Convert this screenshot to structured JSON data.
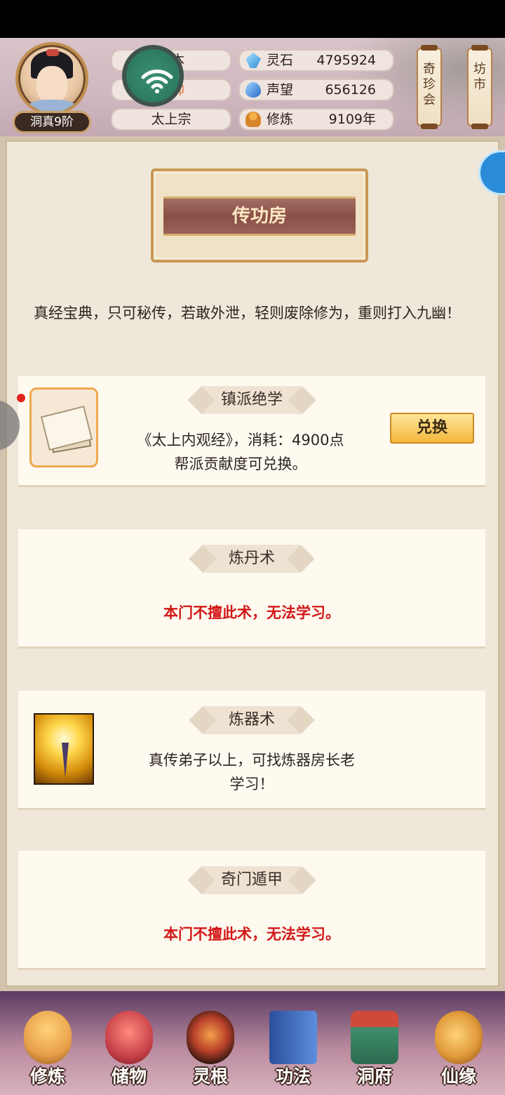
{
  "header": {
    "rank": "洞真9阶",
    "left_pills": [
      {
        "text": "一本"
      },
      {
        "text": "元帅"
      },
      {
        "text": "太上宗"
      }
    ],
    "resources": [
      {
        "icon": "spirit-stone-icon",
        "name": "灵石",
        "value": "4795924"
      },
      {
        "icon": "prestige-icon",
        "name": "声望",
        "value": "656126"
      },
      {
        "icon": "cultivation-icon",
        "name": "修炼",
        "value": "9109年"
      }
    ],
    "side_buttons": [
      "奇珍会",
      "坊市"
    ]
  },
  "page": {
    "title": "传功房",
    "intro": "真经宝典，只可秘传，若敢外泄，轻则废除修为，重则打入九幽！"
  },
  "cards": [
    {
      "title": "镇派绝学",
      "desc_line1": "《太上内观经》，消耗：4900点",
      "desc_line2": "帮派贡献度可兑换。",
      "button": "兑换"
    },
    {
      "title": "炼丹术",
      "desc_line1": "本门不擅此术，无法学习。"
    },
    {
      "title": "炼器术",
      "desc_line1": "真传弟子以上，可找炼器房长老",
      "desc_line2": "学习！"
    },
    {
      "title": "奇门遁甲",
      "desc_line1": "本门不擅此术，无法学习。"
    }
  ],
  "nav": [
    {
      "label": "修炼",
      "icon": "cultivate-icon",
      "color": "#e8a04a"
    },
    {
      "label": "储物",
      "icon": "storage-bag-icon",
      "color": "#c9424a"
    },
    {
      "label": "灵根",
      "icon": "spirit-root-icon",
      "color": "#b8402a"
    },
    {
      "label": "功法",
      "icon": "technique-book-icon",
      "color": "#3b6fc2"
    },
    {
      "label": "洞府",
      "icon": "cave-residence-icon",
      "color": "#3f8f6b"
    },
    {
      "label": "仙缘",
      "icon": "immortal-fate-icon",
      "color": "#e09a3a"
    }
  ]
}
